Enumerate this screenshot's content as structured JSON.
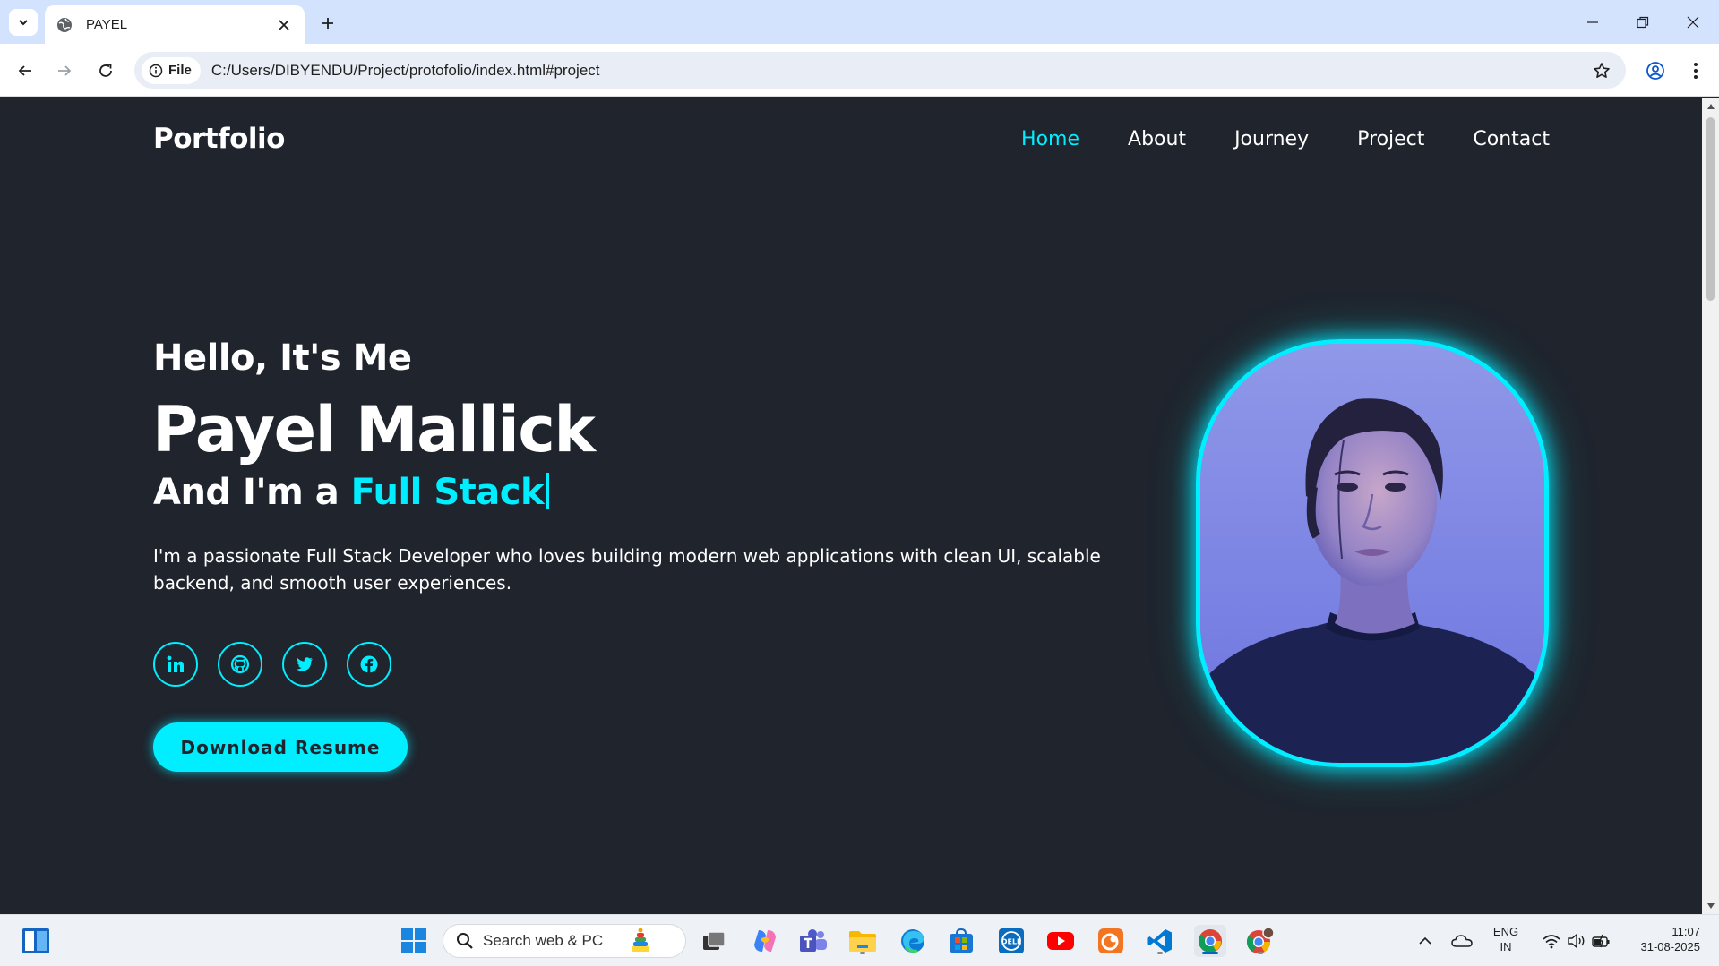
{
  "browser": {
    "tab_title": "PAYEL",
    "site_chip": "File",
    "url": "C:/Users/DIBYENDU/Project/protofolio/index.html#project"
  },
  "page": {
    "logo": "Portfolio",
    "nav": [
      {
        "label": "Home",
        "active": true
      },
      {
        "label": "About"
      },
      {
        "label": "Journey"
      },
      {
        "label": "Project"
      },
      {
        "label": "Contact"
      }
    ],
    "hero": {
      "greeting": "Hello, It's Me",
      "name": "Payel Mallick",
      "role_prefix": "And I'm a",
      "role_highlight": "Full Stack",
      "description": "I'm a passionate Full Stack Developer who loves building modern web applications with clean UI, scalable backend, and smooth user experiences.",
      "socials": [
        "linkedin-icon",
        "github-icon",
        "twitter-icon",
        "facebook-icon"
      ],
      "resume_button": "Download Resume"
    },
    "colors": {
      "accent": "#00eeff",
      "background": "#1f242d",
      "text": "#ffffff"
    }
  },
  "taskbar": {
    "search_placeholder": "Search web & PC",
    "language_line1": "ENG",
    "language_line2": "IN",
    "time": "11:07",
    "date": "31-08-2025"
  }
}
